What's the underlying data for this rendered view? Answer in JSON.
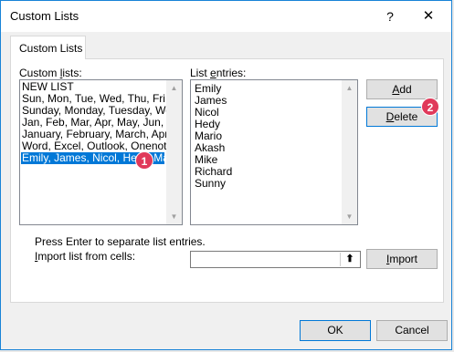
{
  "window": {
    "title": "Custom Lists",
    "help_glyph": "?",
    "close_glyph": "✕"
  },
  "tab": {
    "label": "Custom Lists"
  },
  "custom_lists": {
    "label_pre": "Custom ",
    "label_mnemonic": "l",
    "label_post": "ists:",
    "items": [
      "NEW LIST",
      "Sun, Mon, Tue, Wed, Thu, Fri, S",
      "Sunday, Monday, Tuesday, We",
      "Jan, Feb, Mar, Apr, May, Jun, Ju",
      "January, February, March, Apri",
      "Word, Excel, Outlook, Onenot",
      "Emily, James, Nicol, Hedy, Mari"
    ],
    "selected_index": 6
  },
  "list_entries": {
    "label_pre": "List ",
    "label_mnemonic": "e",
    "label_post": "ntries:",
    "items": [
      "Emily",
      "James",
      "Nicol",
      "Hedy",
      "Mario",
      "Akash",
      "Mike",
      "Richard",
      "Sunny"
    ]
  },
  "buttons": {
    "add_pre": "",
    "add_mnemonic": "A",
    "add_post": "dd",
    "delete_pre": "",
    "delete_mnemonic": "D",
    "delete_post": "elete",
    "import_pre": "",
    "import_mnemonic": "I",
    "import_post": "mport",
    "ok": "OK",
    "cancel": "Cancel"
  },
  "hints": {
    "separate": "Press Enter to separate list entries.",
    "import_pre": "",
    "import_mnemonic": "I",
    "import_post": "mport list from cells:",
    "import_value": "",
    "collapse_glyph": "⬆"
  },
  "badges": {
    "one": "1",
    "two": "2"
  },
  "colors": {
    "selection": "#0078d7",
    "badge": "#e0395a",
    "window_border": "#1883d7"
  }
}
